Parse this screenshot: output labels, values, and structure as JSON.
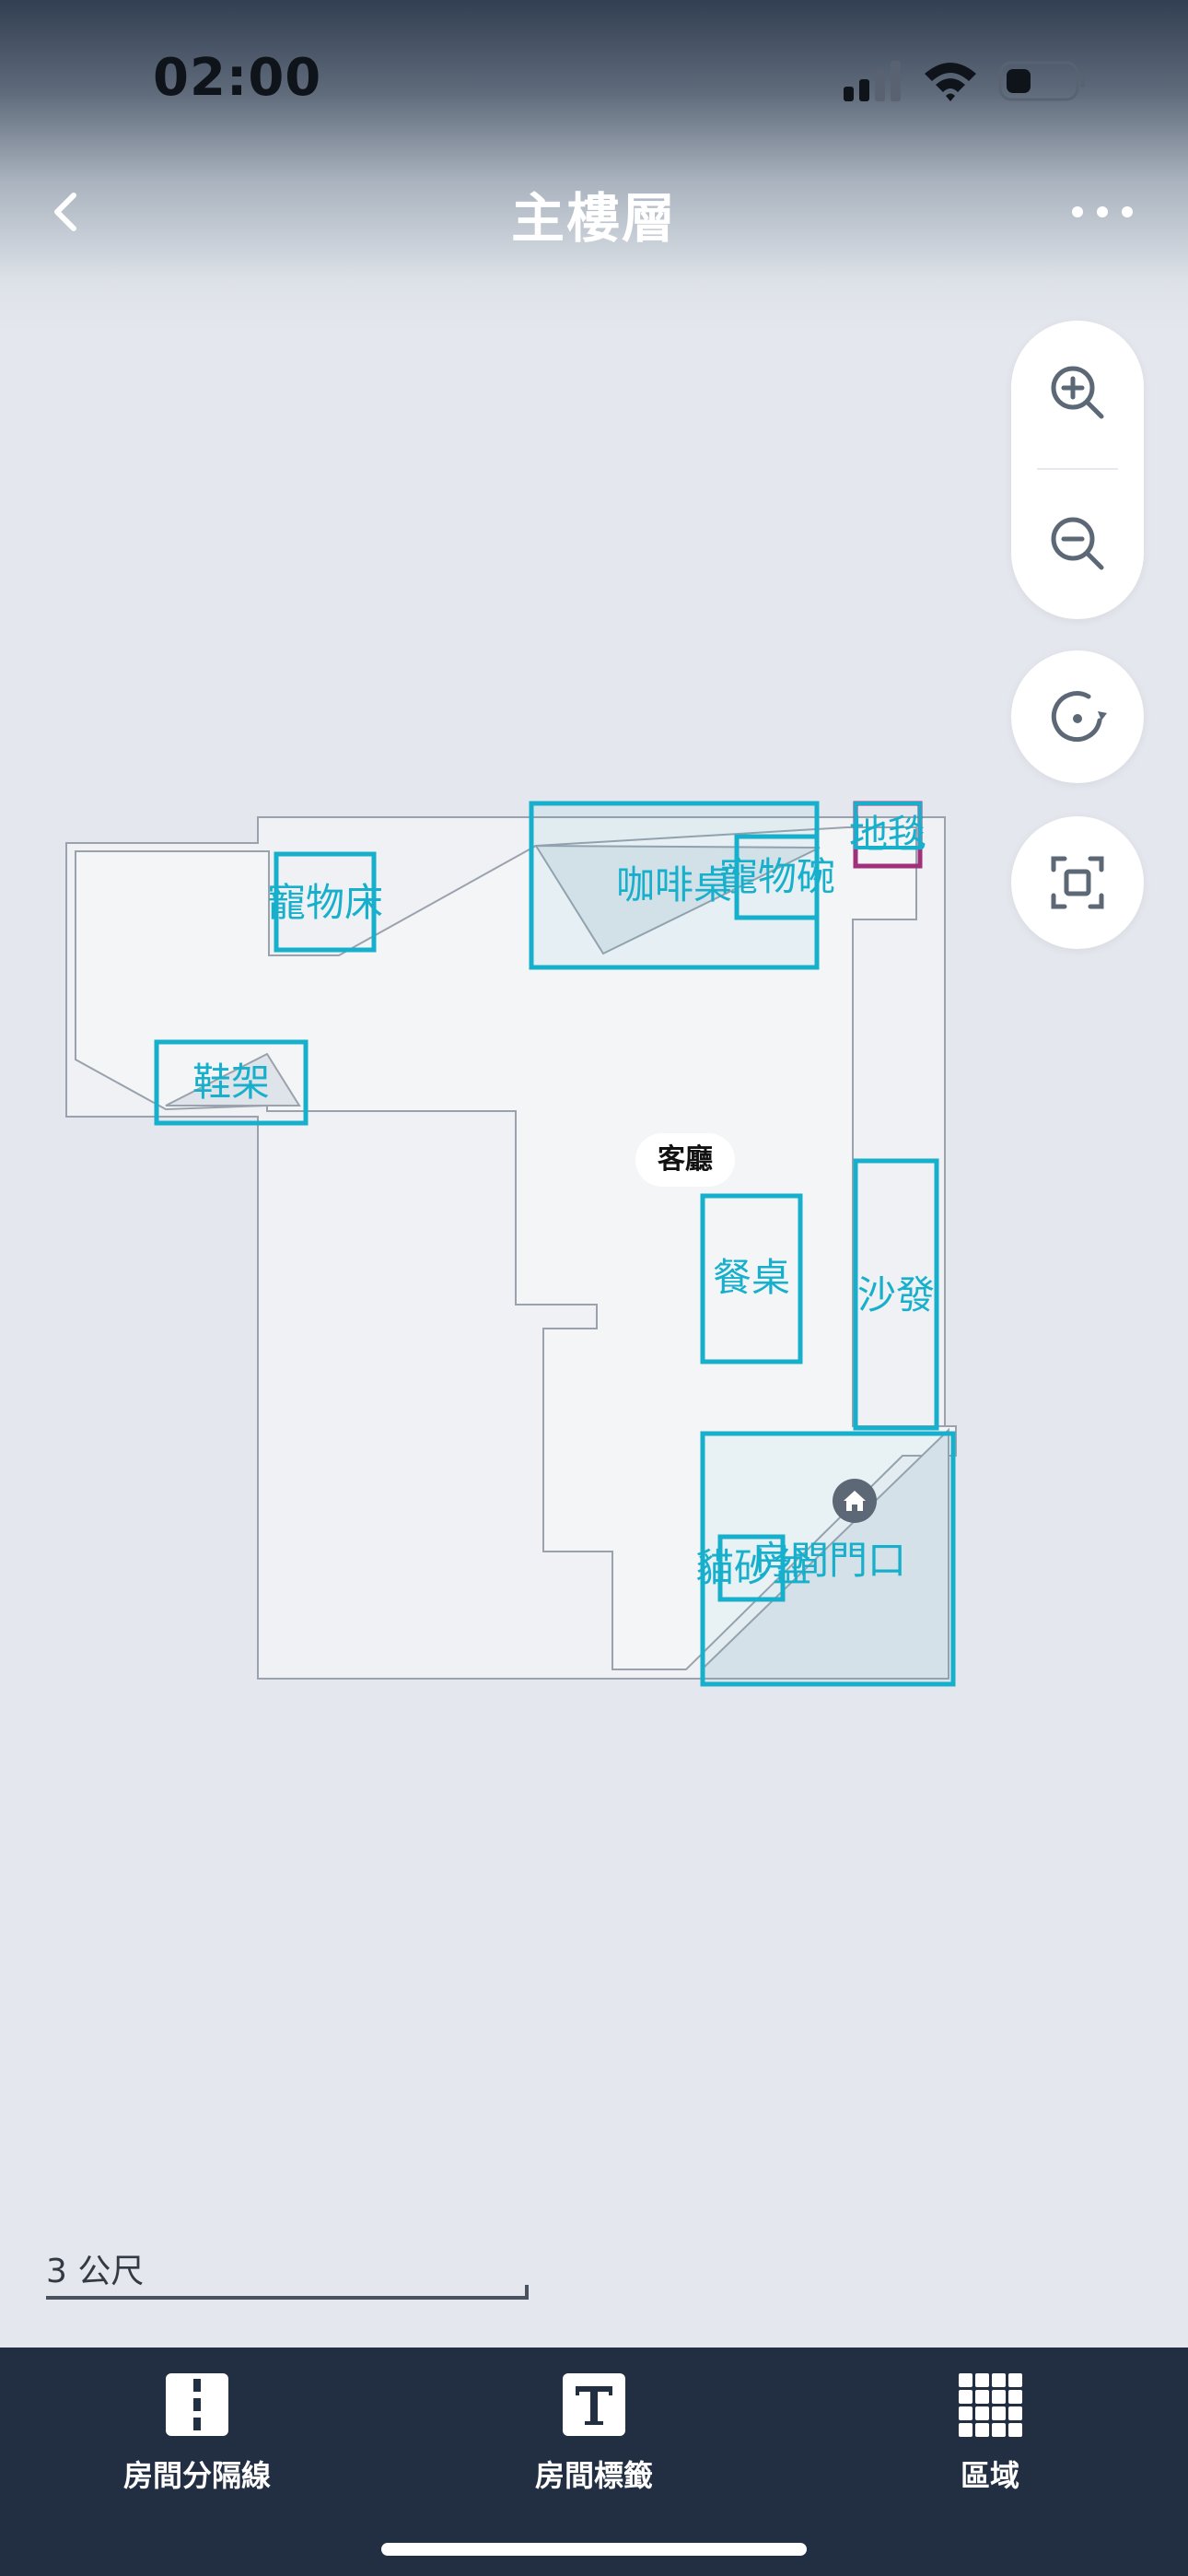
{
  "status_bar": {
    "time": "02:00"
  },
  "header": {
    "title": "主樓層"
  },
  "map": {
    "room_badge": "客廳",
    "objects": {
      "pet_bed": "寵物床",
      "coffee_table": "咖啡桌",
      "pet_bowl": "寵物碗",
      "rug": "地毯",
      "shoe_rack": "鞋架",
      "dining_table": "餐桌",
      "sofa": "沙發",
      "litter_box": "貓砂盆",
      "room_door": "房間門口"
    }
  },
  "scale": {
    "label": "3 公尺"
  },
  "bottom_tabs": [
    {
      "label": "房間分隔線",
      "icon": "room-divider-icon"
    },
    {
      "label": "房間標籤",
      "icon": "text-label-icon"
    },
    {
      "label": "區域",
      "icon": "grid-zone-icon"
    }
  ],
  "colors": {
    "accent_cyan": "#17b0cc",
    "rug_magenta": "#a0307a",
    "bottom_bar": "#222e42",
    "background": "#e4e8ee"
  }
}
